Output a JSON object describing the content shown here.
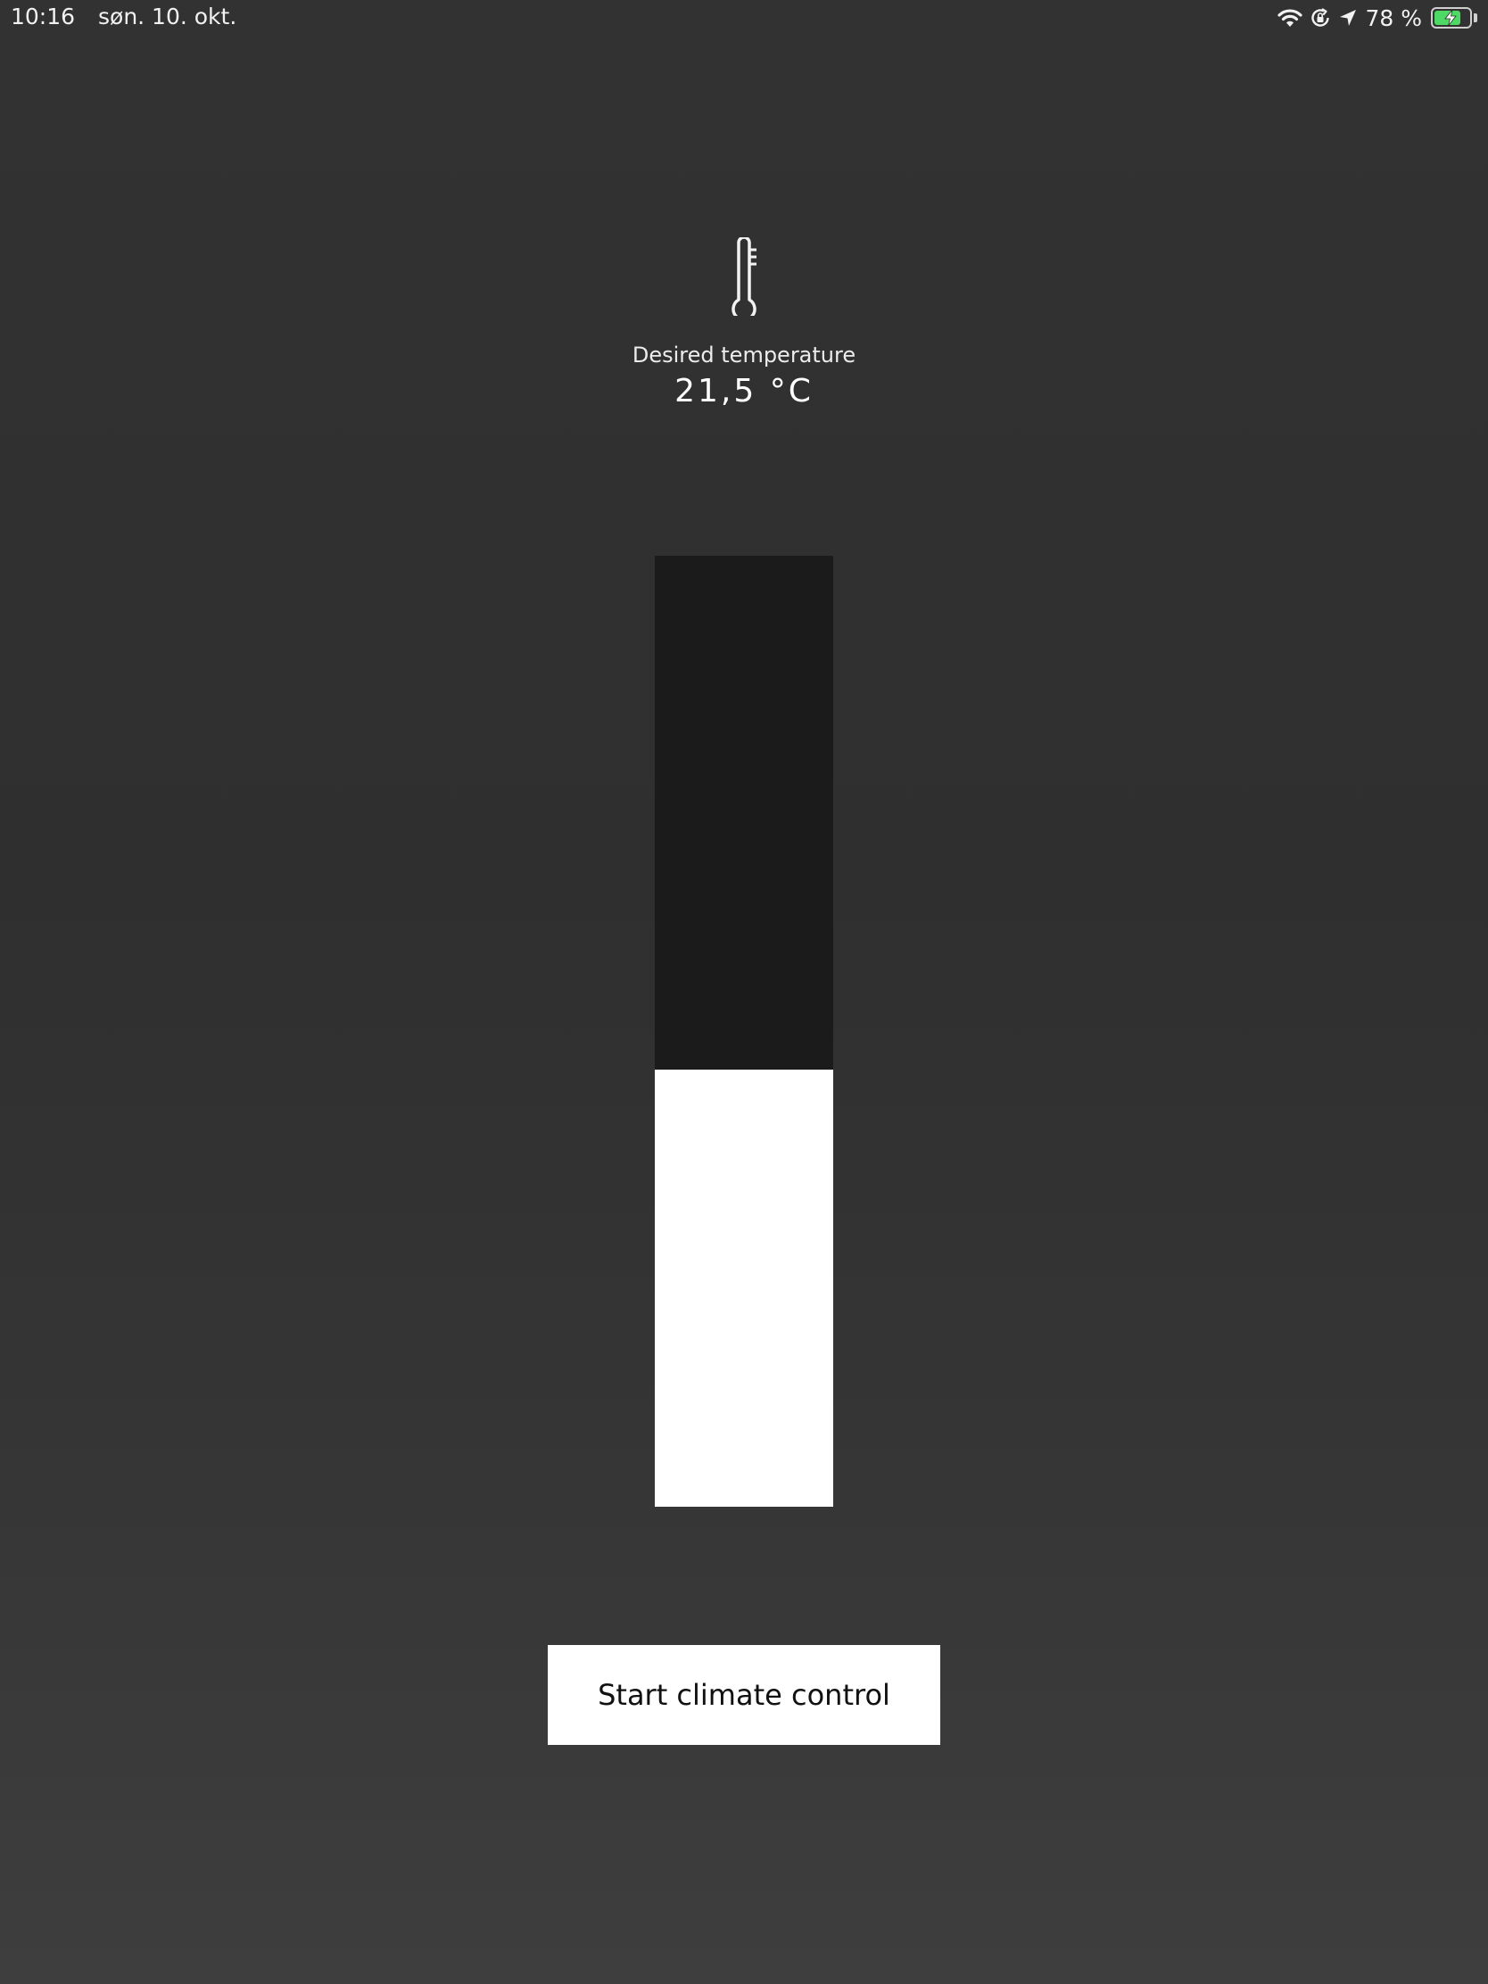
{
  "status_bar": {
    "time": "10:16",
    "date": "søn. 10. okt.",
    "battery_text": "78 %",
    "battery_level": 0.78,
    "battery_color": "#4cd964",
    "icons": [
      "wifi-icon",
      "orientation-lock-icon",
      "location-arrow-icon",
      "battery-icon",
      "charging-bolt-icon"
    ]
  },
  "climate": {
    "icon": "thermometer-icon",
    "label": "Desired temperature",
    "value": "21,5 °C",
    "slider_level": 0.46,
    "slider_track_color": "#1b1b1b",
    "slider_fill_color": "#ffffff"
  },
  "actions": {
    "start_label": "Start climate control"
  }
}
